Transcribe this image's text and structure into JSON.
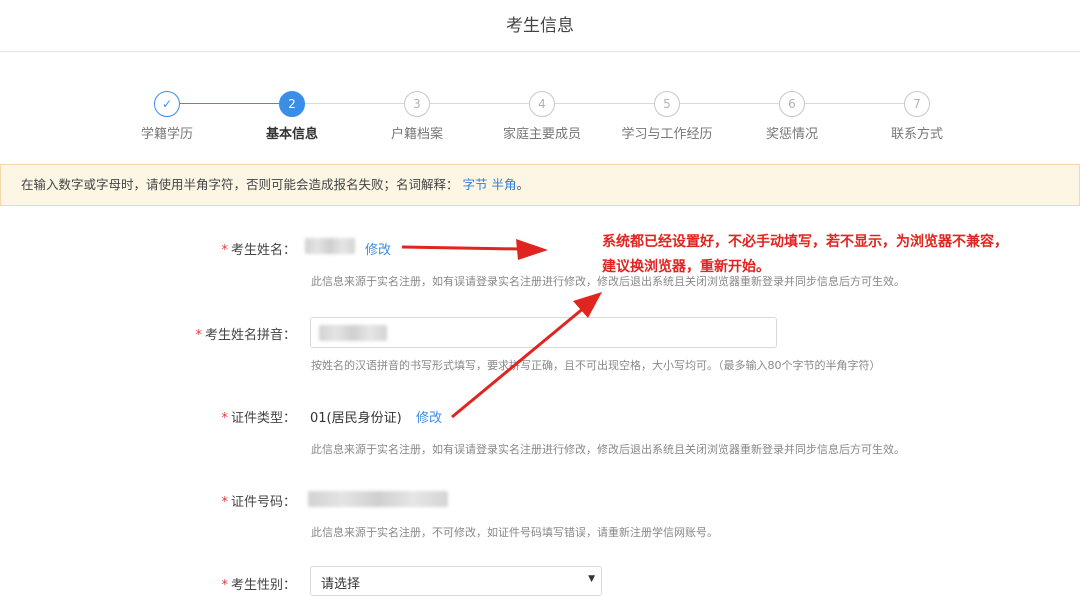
{
  "page": {
    "title": "考生信息"
  },
  "steps": [
    {
      "number": "✓",
      "label": "学籍学历",
      "state": "done"
    },
    {
      "number": "2",
      "label": "基本信息",
      "state": "active"
    },
    {
      "number": "3",
      "label": "户籍档案",
      "state": "pending"
    },
    {
      "number": "4",
      "label": "家庭主要成员",
      "state": "pending"
    },
    {
      "number": "5",
      "label": "学习与工作经历",
      "state": "pending"
    },
    {
      "number": "6",
      "label": "奖惩情况",
      "state": "pending"
    },
    {
      "number": "7",
      "label": "联系方式",
      "state": "pending"
    }
  ],
  "notice": {
    "text": "在输入数字或字母时，请使用半角字符，否则可能会造成报名失败；名词解释：",
    "link1": "字节",
    "link2": "半角",
    "end": "。"
  },
  "form": {
    "required_mark": "*",
    "name": {
      "label": "考生姓名：",
      "edit": "修改",
      "hint": "此信息来源于实名注册，如有误请登录实名注册进行修改，修改后退出系统且关闭浏览器重新登录并同步信息后方可生效。"
    },
    "pinyin": {
      "label": "考生姓名拼音：",
      "hint": "按姓名的汉语拼音的书写形式填写，要求拼写正确，且不可出现空格，大小写均可。（最多输入80个字节的半角字符）"
    },
    "id_type": {
      "label": "证件类型：",
      "value": "01(居民身份证)",
      "edit": "修改",
      "hint": "此信息来源于实名注册，如有误请登录实名注册进行修改，修改后退出系统且关闭浏览器重新登录并同步信息后方可生效。"
    },
    "id_number": {
      "label": "证件号码：",
      "hint": "此信息来源于实名注册，不可修改，如证件号码填写错误，请重新注册学信网账号。"
    },
    "gender": {
      "label": "考生性别：",
      "selected": "请选择"
    }
  },
  "annotation": {
    "line1": "系统都已经设置好，不必手动填写，若不显示，为浏览器不兼容，",
    "line2": "建议换浏览器，重新开始。"
  },
  "colors": {
    "accent": "#3a8ee6",
    "annotation": "#e0241f",
    "required": "#e0393e",
    "notice_bg": "#fdf6e4"
  }
}
